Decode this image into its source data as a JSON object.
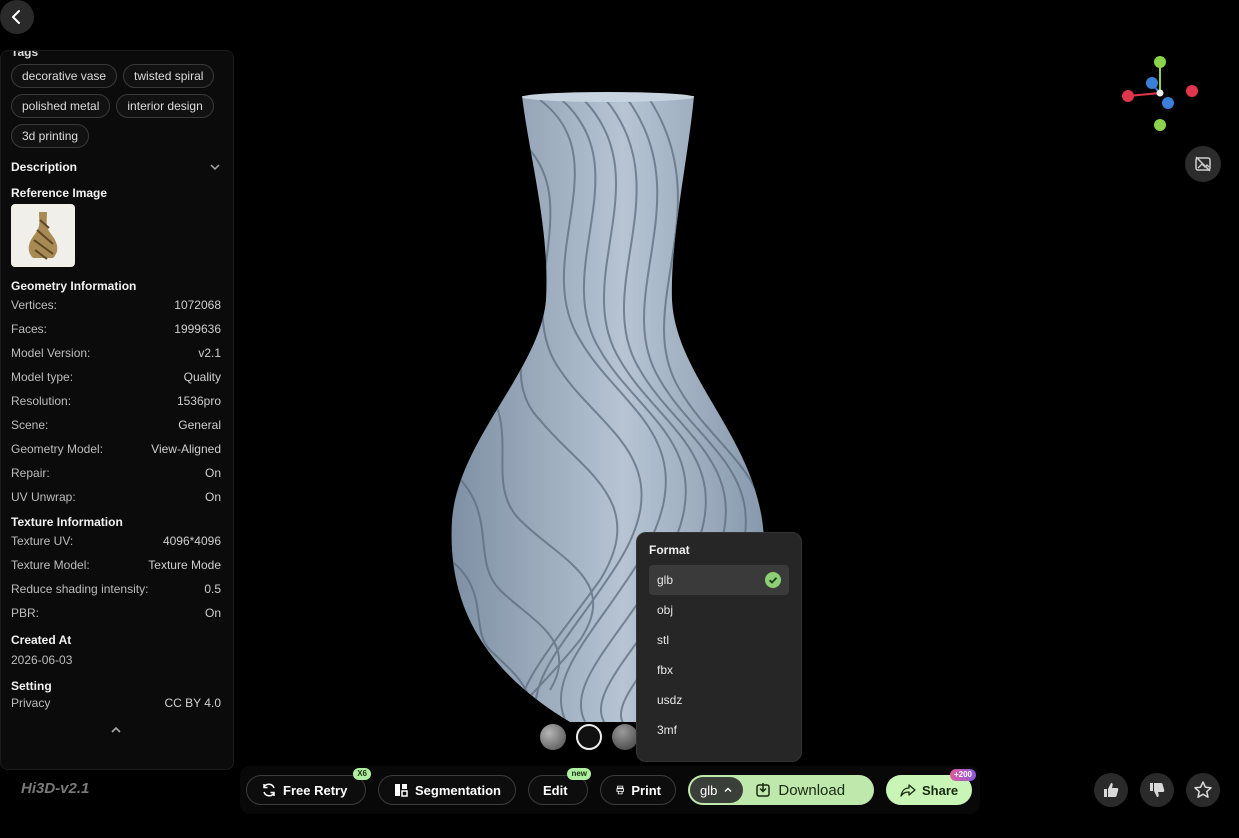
{
  "tags": {
    "title": "Tags",
    "items": [
      "decorative vase",
      "twisted spiral",
      "polished metal",
      "interior design",
      "3d printing"
    ]
  },
  "description": {
    "label": "Description"
  },
  "reference": {
    "label": "Reference Image"
  },
  "geometry": {
    "title": "Geometry Information",
    "rows": [
      {
        "k": "Vertices:",
        "v": "1072068"
      },
      {
        "k": "Faces:",
        "v": "1999636"
      },
      {
        "k": "Model Version:",
        "v": "v2.1"
      },
      {
        "k": "Model type:",
        "v": "Quality"
      },
      {
        "k": "Resolution:",
        "v": "1536pro"
      },
      {
        "k": "Scene:",
        "v": "General"
      },
      {
        "k": "Geometry Model:",
        "v": "View-Aligned"
      },
      {
        "k": "Repair:",
        "v": "On"
      },
      {
        "k": "UV Unwrap:",
        "v": "On"
      }
    ]
  },
  "texture": {
    "title": "Texture Information",
    "rows": [
      {
        "k": "Texture UV:",
        "v": "4096*4096"
      },
      {
        "k": "Texture Model:",
        "v": "Texture Mode"
      },
      {
        "k": "Reduce shading intensity:",
        "v": "0.5"
      },
      {
        "k": "PBR:",
        "v": "On"
      }
    ]
  },
  "created": {
    "title": "Created At",
    "value": "2026-06-03"
  },
  "setting": {
    "title": "Setting",
    "k": "Privacy",
    "v": "CC BY 4.0"
  },
  "brand": "Hi3D-v2.1",
  "format_menu": {
    "title": "Format",
    "selected": "glb",
    "options": [
      "glb",
      "obj",
      "stl",
      "fbx",
      "usdz",
      "3mf"
    ]
  },
  "toolbar": {
    "free_retry": "Free Retry",
    "free_retry_badge": "X6",
    "segmentation": "Segmentation",
    "edit": "Edit",
    "edit_badge": "new",
    "print": "Print",
    "format_value": "glb",
    "download": "Download",
    "share": "Share",
    "share_badge": "+200"
  },
  "colors": {
    "accent_green": "#bfe8ad",
    "share_green": "#c9f5b6",
    "vase": "#9fb0c2",
    "gizmo_x": "#e0374d",
    "gizmo_y": "#8bd34b",
    "gizmo_z": "#3a7fd8"
  },
  "icons": [
    "back-chevron-icon",
    "chevron-down-icon",
    "chevron-up-icon",
    "refresh-icon",
    "segmentation-icon",
    "printer-icon",
    "download-icon",
    "share-icon",
    "thumbs-up-icon",
    "thumbs-down-icon",
    "star-icon",
    "hide-image-icon",
    "check-icon"
  ]
}
